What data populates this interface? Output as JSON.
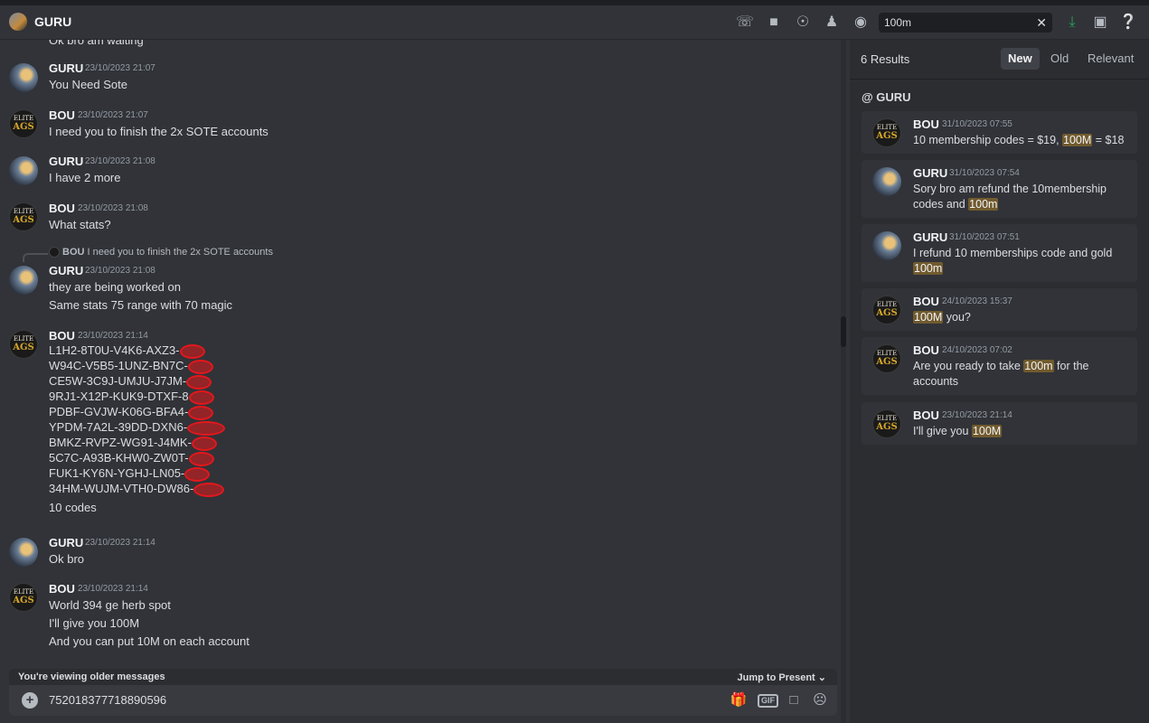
{
  "header": {
    "title": "GURU",
    "search_value": "100m"
  },
  "chat": {
    "top_cut_text": "Ok bro am waiting",
    "messages": [
      {
        "author": "GURU",
        "time": "23/10/2023 21:07",
        "lines": [
          "You Need Sote"
        ]
      },
      {
        "author": "BOU",
        "time": "23/10/2023 21:07",
        "lines": [
          "I need you to finish the 2x SOTE accounts"
        ]
      },
      {
        "author": "GURU",
        "time": "23/10/2023 21:08",
        "lines": [
          "I have 2 more"
        ]
      },
      {
        "author": "BOU",
        "time": "23/10/2023 21:08",
        "lines": [
          "What stats?"
        ]
      },
      {
        "author": "GURU",
        "time": "23/10/2023 21:08",
        "reply": {
          "author": "BOU",
          "text": "I need you to finish the 2x SOTE accounts"
        },
        "lines": [
          "they are being worked on",
          "Same stats 75 range with 70 magic"
        ]
      },
      {
        "author": "BOU",
        "time": "23/10/2023 21:14",
        "lines": [
          "L1H2-8T0U-V4K6-AXZ3-",
          "W94C-V5B5-1UNZ-BN7C-",
          "CE5W-3C9J-UMJU-J7JM-",
          "9RJ1-X12P-KUK9-DTXF-8",
          "PDBF-GVJW-K06G-BFA4-",
          "YPDM-7A2L-39DD-DXN6-",
          "BMKZ-RVPZ-WG91-J4MK-",
          "5C7C-A93B-KHW0-ZW0T-",
          "FUK1-KY6N-YGHJ-LN05-",
          "34HM-WUJM-VTH0-DW86-",
          "10 codes"
        ]
      },
      {
        "author": "GURU",
        "time": "23/10/2023 21:14",
        "lines": [
          "Ok bro"
        ]
      },
      {
        "author": "BOU",
        "time": "23/10/2023 21:14",
        "lines": [
          "World 394 ge herb spot",
          "I'll give you 100M",
          "And you can put 10M on each account"
        ]
      }
    ]
  },
  "composer": {
    "older_label": "You're viewing older messages",
    "jump_label": "Jump to Present",
    "input_value": "752018377718890596",
    "gif_label": "GIF"
  },
  "results": {
    "count_label": "6 Results",
    "sort_tabs": [
      "New",
      "Old",
      "Relevant"
    ],
    "active_tab": "New",
    "channel_label": "@ GURU",
    "items": [
      {
        "author": "BOU",
        "time": "31/10/2023 07:55",
        "parts": [
          "10 membership codes = $19, ",
          "100M",
          " = $18"
        ]
      },
      {
        "author": "GURU",
        "time": "31/10/2023 07:54",
        "parts": [
          "Sory bro am refund the 10membership codes and ",
          "100m",
          ""
        ]
      },
      {
        "author": "GURU",
        "time": "31/10/2023 07:51",
        "parts": [
          "I refund 10 memberships code  and gold ",
          "100m",
          ""
        ]
      },
      {
        "author": "BOU",
        "time": "24/10/2023 15:37",
        "parts": [
          "",
          "100M",
          " you?"
        ]
      },
      {
        "author": "BOU",
        "time": "24/10/2023 07:02",
        "parts": [
          "Are you ready to take ",
          "100m",
          " for the accounts"
        ]
      },
      {
        "author": "BOU",
        "time": "23/10/2023 21:14",
        "parts": [
          "I'll give you ",
          "100M",
          ""
        ]
      }
    ]
  },
  "avatar_text": {
    "line1": "ELITE",
    "line2": "AGS"
  },
  "colors": {
    "background": "#313338",
    "sidebar": "#2b2d31",
    "highlight": "#715b2f",
    "redaction": "#e3171c",
    "download_icon": "#23a55a"
  }
}
